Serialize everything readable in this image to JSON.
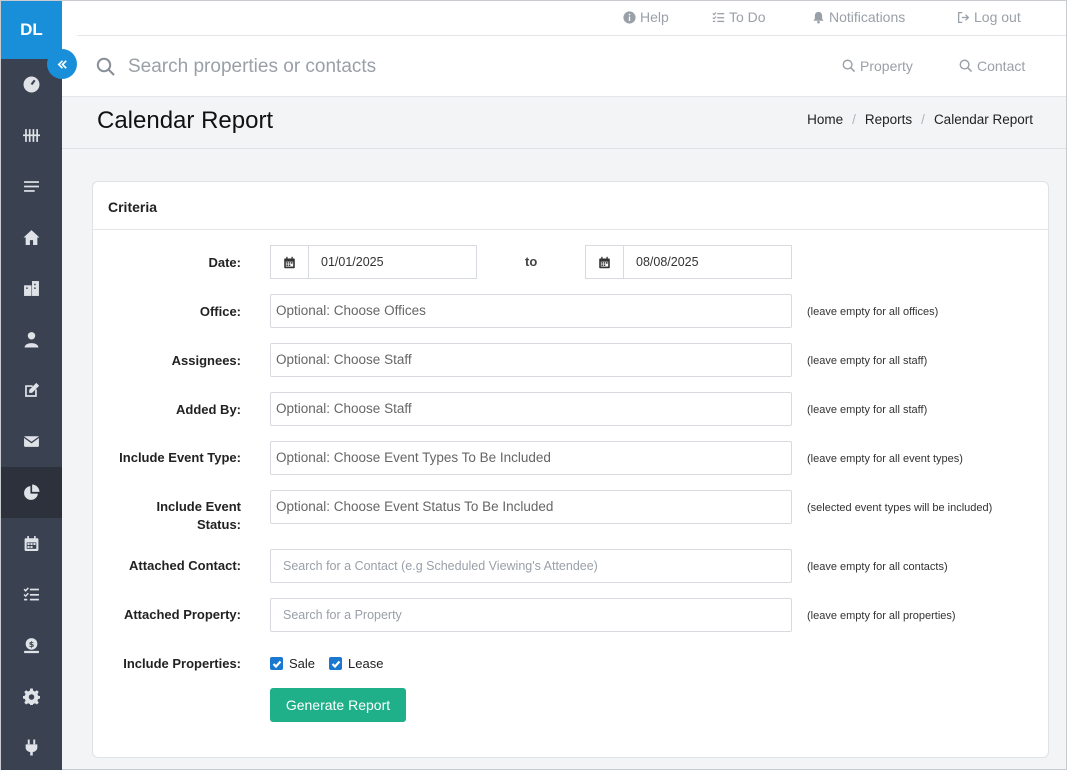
{
  "sidebar": {
    "logo": "DL",
    "items": [
      {
        "icon": "dashboard-icon"
      },
      {
        "icon": "tally-icon"
      },
      {
        "icon": "list-icon"
      },
      {
        "icon": "home-icon"
      },
      {
        "icon": "buildings-icon"
      },
      {
        "icon": "person-icon"
      },
      {
        "icon": "edit-icon"
      },
      {
        "icon": "envelope-icon"
      },
      {
        "icon": "pie-chart-icon",
        "active": true
      },
      {
        "icon": "calendar-icon"
      },
      {
        "icon": "checklist-icon"
      },
      {
        "icon": "money-icon"
      },
      {
        "icon": "gear-icon"
      },
      {
        "icon": "plug-icon"
      }
    ]
  },
  "toplinks": {
    "help": "Help",
    "todo": "To Do",
    "notifications": "Notifications",
    "logout": "Log out"
  },
  "search": {
    "placeholder": "Search properties or contacts",
    "property_label": "Property",
    "contact_label": "Contact"
  },
  "page": {
    "title": "Calendar Report",
    "breadcrumb": [
      "Home",
      "Reports",
      "Calendar Report"
    ]
  },
  "criteria": {
    "title": "Criteria",
    "date_label": "Date:",
    "date_from": "01/01/2025",
    "to_label": "to",
    "date_to": "08/08/2025",
    "office_label": "Office:",
    "office_placeholder": "Optional: Choose Offices",
    "office_hint": "(leave empty for all offices)",
    "assignees_label": "Assignees:",
    "assignees_placeholder": "Optional: Choose Staff",
    "assignees_hint": "(leave empty for all staff)",
    "added_by_label": "Added By:",
    "added_by_placeholder": "Optional: Choose Staff",
    "added_by_hint": "(leave empty for all staff)",
    "event_type_label": "Include Event Type:",
    "event_type_placeholder": "Optional: Choose Event Types To Be Included",
    "event_type_hint": "(leave empty for all event types)",
    "event_status_label_1": "Include Event",
    "event_status_label_2": "Status:",
    "event_status_placeholder": "Optional: Choose Event Status To Be Included",
    "event_status_hint": "(selected event types will be included)",
    "contact_label": "Attached Contact:",
    "contact_placeholder": "Search for a Contact (e.g Scheduled Viewing's Attendee)",
    "contact_hint": "(leave empty for all contacts)",
    "property_label": "Attached Property:",
    "property_placeholder": "Search for a Property",
    "property_hint": "(leave empty for all properties)",
    "include_properties_label": "Include Properties:",
    "sale_label": "Sale",
    "sale_checked": true,
    "lease_label": "Lease",
    "lease_checked": true,
    "generate_label": "Generate Report"
  },
  "colors": {
    "sidebar": "#3a4150",
    "accent": "#1a8fd9",
    "button": "#1fb08a"
  }
}
